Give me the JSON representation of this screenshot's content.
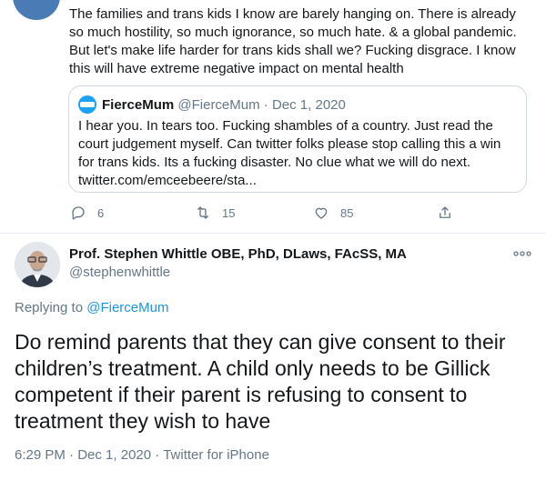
{
  "previous_tweet": {
    "text": "The families and trans kids I know are barely hanging on. There is already so much hostility, so much ignorance, so much hate. & a global pandemic. But let's make life harder for trans kids shall we? Fucking disgrace. I know this will have extreme negative impact on mental health",
    "quoted": {
      "name": "FierceMum",
      "handle": "@FierceMum",
      "separator": "·",
      "date": "Dec 1, 2020",
      "text": "I hear you. In tears too. Fucking shambles of a country. Just read the court judgement myself. Can twitter folks please stop calling this a win for trans kids. Its a fucking disaster. No clue what we will do next. twitter.com/emceebeere/sta..."
    },
    "actions": {
      "replies": "6",
      "retweets": "15",
      "likes": "85"
    }
  },
  "main_tweet": {
    "name": "Prof. Stephen Whittle OBE, PhD, DLaws, FAcSS, MA",
    "handle": "@stephenwhittle",
    "replying_prefix": "Replying to",
    "replying_to": "@FierceMum",
    "text": "Do remind parents that they can give consent to their children’s treatment. A child only needs to be Gillick competent if their parent is refusing to consent to treatment they wish to have",
    "time": "6:29 PM",
    "date": "Dec 1, 2020",
    "source": "Twitter for iPhone",
    "separator": "·"
  },
  "colors": {
    "text": "#14171a",
    "secondary": "#657786",
    "link": "#1b95e0",
    "border": "#cfd9de"
  }
}
